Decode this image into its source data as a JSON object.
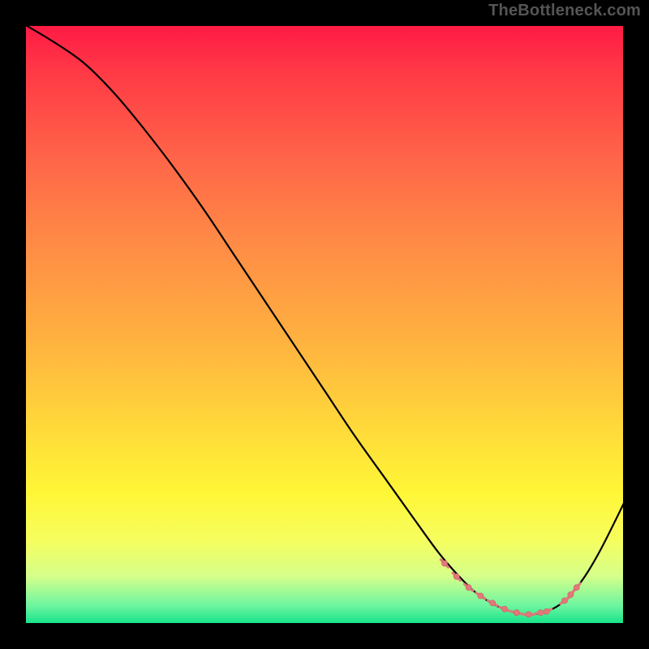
{
  "watermark": "TheBottleneck.com",
  "chart_data": {
    "type": "line",
    "title": "",
    "xlabel": "",
    "ylabel": "",
    "xlim": [
      0,
      100
    ],
    "ylim": [
      0,
      100
    ],
    "grid": false,
    "series": [
      {
        "name": "bottleneck-curve",
        "x": [
          0,
          5,
          10,
          15,
          20,
          25,
          30,
          35,
          40,
          45,
          50,
          55,
          60,
          65,
          69,
          72,
          75,
          78,
          81,
          84,
          87,
          90,
          93,
          96,
          100
        ],
        "y": [
          100,
          97,
          93.5,
          88.5,
          82.5,
          76,
          69,
          61.5,
          54,
          46.5,
          39,
          31.5,
          24.5,
          17.5,
          12,
          8.5,
          5.5,
          3.5,
          2.2,
          1.7,
          2.2,
          4.0,
          7.5,
          12.5,
          20.5
        ]
      }
    ],
    "markers": {
      "name": "optimal-band-markers",
      "x": [
        70,
        72,
        74,
        76,
        78,
        80,
        82,
        84,
        86,
        87,
        90,
        91,
        92
      ],
      "y": [
        10.2,
        8.0,
        6.2,
        4.8,
        3.6,
        2.6,
        2.0,
        1.7,
        2.0,
        2.2,
        4.0,
        5.0,
        6.2
      ]
    },
    "background": {
      "type": "vertical-gradient",
      "stops": [
        {
          "pos": 0.0,
          "color": "#ff1a45"
        },
        {
          "pos": 0.22,
          "color": "#ff6448"
        },
        {
          "pos": 0.52,
          "color": "#ffb040"
        },
        {
          "pos": 0.78,
          "color": "#fff636"
        },
        {
          "pos": 0.92,
          "color": "#d6ff8a"
        },
        {
          "pos": 1.0,
          "color": "#14e38a"
        }
      ]
    }
  }
}
